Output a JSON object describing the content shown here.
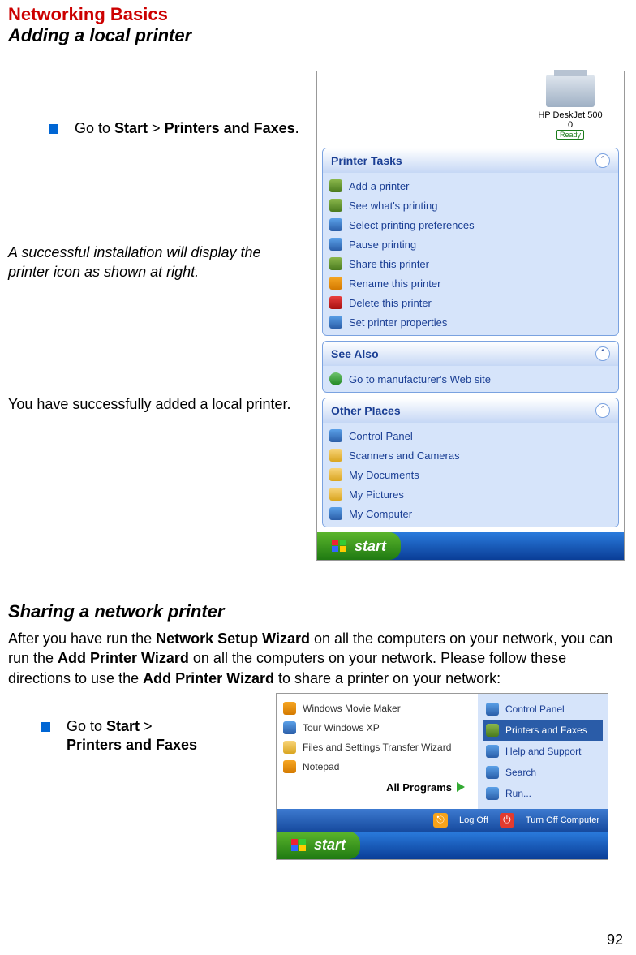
{
  "header": {
    "title1": "Networking Basics",
    "title2": "Adding a local printer"
  },
  "step": {
    "pre": "Go to ",
    "b1": "Start",
    "mid": " > ",
    "b2": "Printers and  Faxes",
    "post": "."
  },
  "note1": "A successful installation will display the printer icon as shown at right.",
  "note2": "You have successfully added a local printer.",
  "printer": {
    "name": "HP DeskJet 500",
    "status1": "0",
    "status2": "Ready"
  },
  "panels": {
    "tasks": {
      "title": "Printer Tasks",
      "items": [
        "Add a printer",
        "See what's printing",
        "Select printing preferences",
        "Pause printing",
        "Share this printer",
        "Rename this  printer",
        "Delete this printer",
        "Set printer properties"
      ]
    },
    "see": {
      "title": "See Also",
      "items": [
        "Go to manufacturer's Web site"
      ]
    },
    "other": {
      "title": "Other Places",
      "items": [
        "Control Panel",
        "Scanners and Cameras",
        "My Documents",
        "My Pictures",
        "My Computer"
      ]
    }
  },
  "start": "start",
  "section2": {
    "title": "Sharing a network printer",
    "para_pre": "After you have run the ",
    "b1": "Network Setup Wizard",
    "mid1": " on all the computers on your network, you can run the ",
    "b2": "Add Printer Wizard",
    "mid2": " on all the computers on your network.  Please follow these directions to use the ",
    "b3": "Add Printer Wizard",
    "mid3": " to share a printer on your network:"
  },
  "step2": {
    "pre": "Go to ",
    "b1": "Start",
    "mid": " > ",
    "b2": "Printers and Faxes"
  },
  "startmenu": {
    "left": [
      "Windows Movie Maker",
      "Tour Windows XP",
      "Files and Settings Transfer Wizard",
      "Notepad"
    ],
    "right": [
      "Control Panel",
      "Printers and Faxes",
      "Help and Support",
      "Search",
      "Run..."
    ],
    "all": "All Programs",
    "logoff": "Log Off",
    "turnoff": "Turn Off Computer"
  },
  "pagenum": "92"
}
